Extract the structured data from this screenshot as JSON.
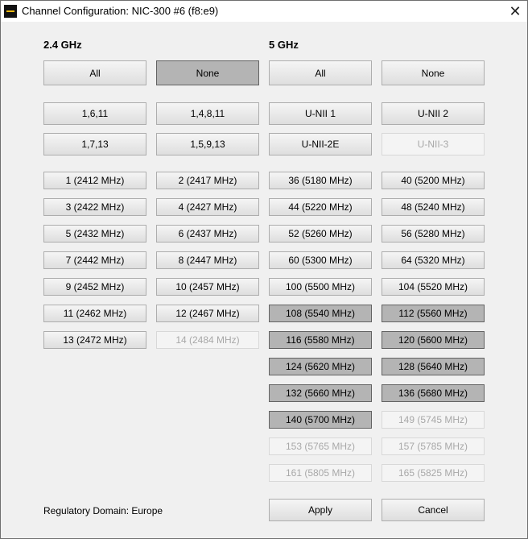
{
  "window": {
    "title": "Channel Configuration: NIC-300 #6 (f8:e9)"
  },
  "band24": {
    "title": "2.4 GHz",
    "all_label": "All",
    "none_label": "None",
    "presets": [
      {
        "id": "1-6-11",
        "label": "1,6,11",
        "state": "normal"
      },
      {
        "id": "1-4-8-11",
        "label": "1,4,8,11",
        "state": "normal"
      },
      {
        "id": "1-7-13",
        "label": "1,7,13",
        "state": "normal"
      },
      {
        "id": "1-5-9-13",
        "label": "1,5,9,13",
        "state": "normal"
      }
    ],
    "channels": [
      {
        "id": "ch1",
        "label": "1 (2412 MHz)",
        "state": "normal"
      },
      {
        "id": "ch2",
        "label": "2 (2417 MHz)",
        "state": "normal"
      },
      {
        "id": "ch3",
        "label": "3 (2422 MHz)",
        "state": "normal"
      },
      {
        "id": "ch4",
        "label": "4 (2427 MHz)",
        "state": "normal"
      },
      {
        "id": "ch5",
        "label": "5 (2432 MHz)",
        "state": "normal"
      },
      {
        "id": "ch6",
        "label": "6 (2437 MHz)",
        "state": "normal"
      },
      {
        "id": "ch7",
        "label": "7 (2442 MHz)",
        "state": "normal"
      },
      {
        "id": "ch8",
        "label": "8 (2447 MHz)",
        "state": "normal"
      },
      {
        "id": "ch9",
        "label": "9 (2452 MHz)",
        "state": "normal"
      },
      {
        "id": "ch10",
        "label": "10 (2457 MHz)",
        "state": "normal"
      },
      {
        "id": "ch11",
        "label": "11 (2462 MHz)",
        "state": "normal"
      },
      {
        "id": "ch12",
        "label": "12 (2467 MHz)",
        "state": "normal"
      },
      {
        "id": "ch13",
        "label": "13 (2472 MHz)",
        "state": "normal"
      },
      {
        "id": "ch14",
        "label": "14 (2484 MHz)",
        "state": "disabled"
      }
    ]
  },
  "band5": {
    "title": "5 GHz",
    "all_label": "All",
    "none_label": "None",
    "presets": [
      {
        "id": "unii-1",
        "label": "U-NII 1",
        "state": "normal"
      },
      {
        "id": "unii-2",
        "label": "U-NII 2",
        "state": "normal"
      },
      {
        "id": "unii-2e",
        "label": "U-NII-2E",
        "state": "normal"
      },
      {
        "id": "unii-3",
        "label": "U-NII-3",
        "state": "disabled"
      }
    ],
    "channels": [
      {
        "id": "ch36",
        "label": "36 (5180 MHz)",
        "state": "normal"
      },
      {
        "id": "ch40",
        "label": "40 (5200 MHz)",
        "state": "normal"
      },
      {
        "id": "ch44",
        "label": "44 (5220 MHz)",
        "state": "normal"
      },
      {
        "id": "ch48",
        "label": "48 (5240 MHz)",
        "state": "normal"
      },
      {
        "id": "ch52",
        "label": "52 (5260 MHz)",
        "state": "normal"
      },
      {
        "id": "ch56",
        "label": "56 (5280 MHz)",
        "state": "normal"
      },
      {
        "id": "ch60",
        "label": "60 (5300 MHz)",
        "state": "normal"
      },
      {
        "id": "ch64",
        "label": "64 (5320 MHz)",
        "state": "normal"
      },
      {
        "id": "ch100",
        "label": "100 (5500 MHz)",
        "state": "normal"
      },
      {
        "id": "ch104",
        "label": "104 (5520 MHz)",
        "state": "normal"
      },
      {
        "id": "ch108",
        "label": "108 (5540 MHz)",
        "state": "selected"
      },
      {
        "id": "ch112",
        "label": "112 (5560 MHz)",
        "state": "selected"
      },
      {
        "id": "ch116",
        "label": "116 (5580 MHz)",
        "state": "selected"
      },
      {
        "id": "ch120",
        "label": "120 (5600 MHz)",
        "state": "selected"
      },
      {
        "id": "ch124",
        "label": "124 (5620 MHz)",
        "state": "selected"
      },
      {
        "id": "ch128",
        "label": "128 (5640 MHz)",
        "state": "selected"
      },
      {
        "id": "ch132",
        "label": "132 (5660 MHz)",
        "state": "selected"
      },
      {
        "id": "ch136",
        "label": "136 (5680 MHz)",
        "state": "selected"
      },
      {
        "id": "ch140",
        "label": "140 (5700 MHz)",
        "state": "selected"
      },
      {
        "id": "ch149",
        "label": "149 (5745 MHz)",
        "state": "disabled"
      },
      {
        "id": "ch153",
        "label": "153 (5765 MHz)",
        "state": "disabled"
      },
      {
        "id": "ch157",
        "label": "157 (5785 MHz)",
        "state": "disabled"
      },
      {
        "id": "ch161",
        "label": "161 (5805 MHz)",
        "state": "disabled"
      },
      {
        "id": "ch165",
        "label": "165 (5825 MHz)",
        "state": "disabled"
      }
    ]
  },
  "footer": {
    "regulatory_domain": "Regulatory Domain: Europe",
    "apply_label": "Apply",
    "cancel_label": "Cancel"
  },
  "colors": {
    "selected": "#b4b4b4",
    "disabled_text": "#a8a8a8",
    "app_icon_accent": "#f2b90f"
  }
}
